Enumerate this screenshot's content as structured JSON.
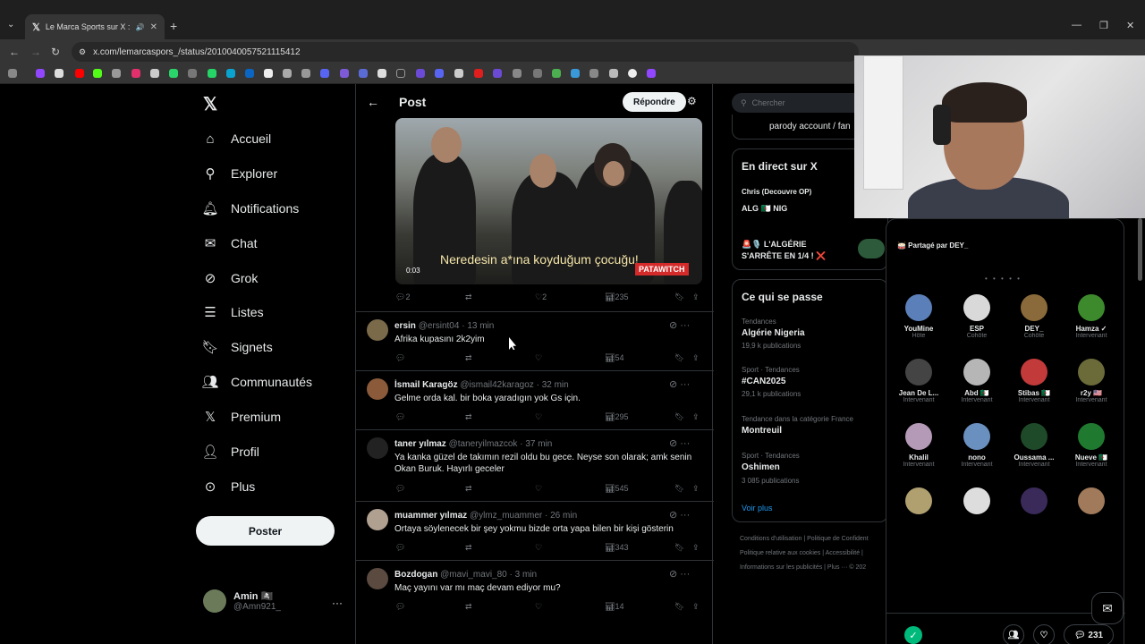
{
  "browser": {
    "tab_title": "Le Marca Sports sur X : \"Vi",
    "url": "x.com/lemarcaspors_/status/2010040057521115412"
  },
  "nav": {
    "items": [
      {
        "label": "Accueil",
        "icon": "home-icon"
      },
      {
        "label": "Explorer",
        "icon": "search-icon"
      },
      {
        "label": "Notifications",
        "icon": "bell-icon"
      },
      {
        "label": "Chat",
        "icon": "mail-icon"
      },
      {
        "label": "Grok",
        "icon": "grok-icon"
      },
      {
        "label": "Listes",
        "icon": "list-icon"
      },
      {
        "label": "Signets",
        "icon": "bookmark-icon"
      },
      {
        "label": "Communautés",
        "icon": "people-icon"
      },
      {
        "label": "Premium",
        "icon": "x-icon"
      },
      {
        "label": "Profil",
        "icon": "person-icon"
      },
      {
        "label": "Plus",
        "icon": "more-icon"
      }
    ],
    "post_button": "Poster",
    "user": {
      "name": "Amin 🏴‍☠️",
      "handle": "@Amn921_"
    }
  },
  "post": {
    "header_title": "Post",
    "reply_button": "Répondre",
    "video_caption": "Neredesin a*ına koyduğum çocuğu!",
    "video_time": "0:03",
    "video_badge": "PATAWITCH",
    "stats": {
      "replies": "2",
      "likes": "2",
      "views": "235"
    }
  },
  "replies": [
    {
      "name": "ersin",
      "handle": "@ersint04",
      "time": "13 min",
      "text": "Afrika kupasını 2k2yim",
      "views": "54"
    },
    {
      "name": "İsmail Karagöz",
      "handle": "@ismail42karagoz",
      "time": "32 min",
      "text": "Gelme orda kal. bir boka yaradıgın yok Gs için.",
      "views": "295"
    },
    {
      "name": "taner yılmaz",
      "handle": "@taneryilmazcok",
      "time": "37 min",
      "text": "Ya kanka güzel de takımın rezil oldu bu gece. Neyse son olarak; amk senin Okan Buruk. Hayırlı geceler",
      "views": "545"
    },
    {
      "name": "muammer yılmaz",
      "handle": "@ylmz_muammer",
      "time": "26 min",
      "text": "Ortaya söylenecek bir şey yokmu bizde orta yapa bilen bir kişi gösterin",
      "views": "343"
    },
    {
      "name": "Bozdogan",
      "handle": "@mavi_mavi_80",
      "time": "3 min",
      "text": "Maç yayını var mı maç devam ediyor mu?",
      "views": "14"
    }
  ],
  "right": {
    "search_placeholder": "Chercher",
    "parody": "parody account / fan",
    "live_title": "En direct sur X",
    "live_items": [
      {
        "host": "Chris (Decouvre OP)",
        "title": "ALG 🇩🇿 NIG"
      },
      {
        "host": "",
        "title": "🚨🎙️ L'ALGÉRIE S'ARRÊTE EN 1/4 ! ❌"
      }
    ],
    "trends_title": "Ce qui se passe",
    "trends": [
      {
        "category": "Tendances",
        "name": "Algérie Nigeria",
        "count": "19,9 k publications"
      },
      {
        "category": "Sport · Tendances",
        "name": "#CAN2025",
        "count": "29,1 k publications"
      },
      {
        "category": "Tendance dans la catégorie France",
        "name": "Montreuil",
        "count": ""
      },
      {
        "category": "Sport · Tendances",
        "name": "Oshimen",
        "count": "3 085 publications"
      }
    ],
    "see_more": "Voir plus",
    "footer": [
      "Conditions d'utilisation  |  Politique de Confident",
      "Politique relative aux cookies  |  Accessibilité  |",
      "Informations sur les publicités  |  Plus ···  © 202"
    ]
  },
  "spaces": {
    "shared_by": "🥁 Partagé par DEY_",
    "speakers": [
      {
        "name": "YouMine",
        "role": "Hôte",
        "color": "#5b7fb8"
      },
      {
        "name": "ESP",
        "role": "Cohôte",
        "color": "#d9d9d9"
      },
      {
        "name": "DEY_",
        "role": "Cohôte",
        "color": "#8a6a3a"
      },
      {
        "name": "Hamza ✓",
        "role": "Intervenant",
        "color": "#3c8a2c"
      },
      {
        "name": "Jean De L...",
        "role": "Intervenant",
        "color": "#444"
      },
      {
        "name": "Abd 🇩🇿",
        "role": "Intervenant",
        "color": "#b6b6b6"
      },
      {
        "name": "Stibas 🇩🇿",
        "role": "Intervenant",
        "color": "#c23a3a"
      },
      {
        "name": "r2y 🇺🇸",
        "role": "Intervenant",
        "color": "#6b6b3a"
      },
      {
        "name": "Khalil",
        "role": "Intervenant",
        "color": "#b59ab8"
      },
      {
        "name": "nono",
        "role": "Intervenant",
        "color": "#6a90c0"
      },
      {
        "name": "Oussama ...",
        "role": "Intervenant",
        "color": "#1f4a2a"
      },
      {
        "name": "Nueve 🇩🇿",
        "role": "Intervenant",
        "color": "#1f7a30"
      }
    ],
    "comments": "231"
  }
}
